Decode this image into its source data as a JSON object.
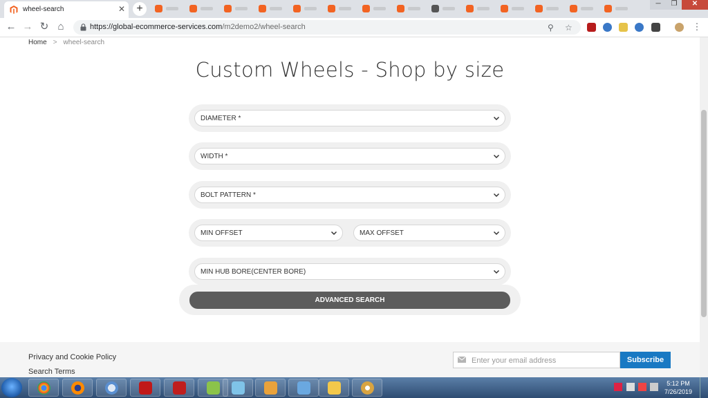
{
  "browser": {
    "tab_title": "wheel-search",
    "new_tab": "+",
    "close_tab": "✕",
    "url_host": "https://global-ecommerce-services.com",
    "url_path": "/m2demo2/wheel-search"
  },
  "breadcrumb": {
    "home": "Home",
    "separator": ">",
    "current": "wheel-search"
  },
  "page": {
    "title": "Custom Wheels - Shop by size"
  },
  "form": {
    "diameter": "DIAMETER *",
    "width": "WIDTH *",
    "bolt_pattern": "BOLT PATTERN *",
    "min_offset": "MIN OFFSET",
    "max_offset": "MAX OFFSET",
    "hub_bore": "MIN HUB BORE(CENTER BORE)",
    "submit": "ADVANCED SEARCH"
  },
  "footer": {
    "privacy": "Privacy and Cookie Policy",
    "search_terms": "Search Terms",
    "email_placeholder": "Enter your email address",
    "subscribe": "Subscribe"
  },
  "taskbar": {
    "time": "5:12 PM",
    "date": "7/26/2019"
  },
  "colors": {
    "accent": "#1979c3",
    "button": "#5c5c5c",
    "magento": "#f26322"
  }
}
